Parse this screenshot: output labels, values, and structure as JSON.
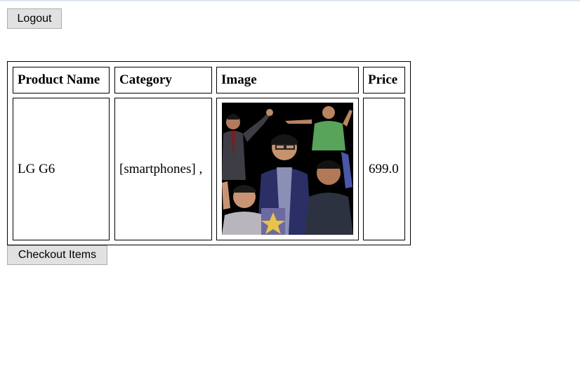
{
  "actions": {
    "logout_label": "Logout",
    "checkout_label": "Checkout Items"
  },
  "table": {
    "headers": [
      "Product Name",
      "Category",
      "Image",
      "Price"
    ],
    "rows": [
      {
        "product_name": "LG G6",
        "category": "[smartphones] ,",
        "price": "699.0"
      }
    ]
  },
  "colors": {
    "button_bg": "#e1e1e1",
    "button_border": "#adadad",
    "top_border": "#dfe6f3",
    "image_bg": "#000000"
  }
}
